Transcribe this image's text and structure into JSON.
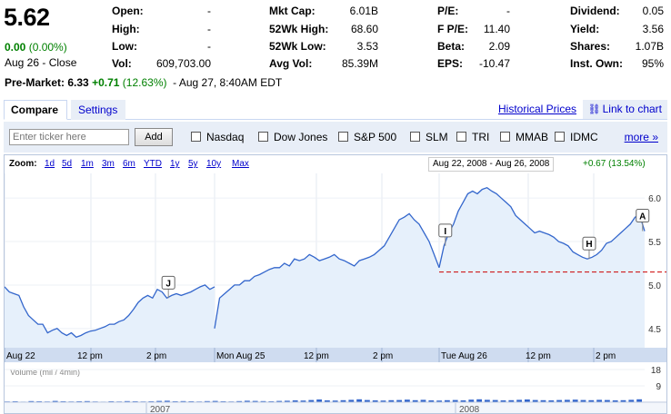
{
  "quote": {
    "price": "5.62",
    "change": "0.00",
    "change_pct": "(0.00%)",
    "close_info": "Aug 26 - Close",
    "premarket_label": "Pre-Market:",
    "premarket_price": "6.33",
    "premarket_change": "+0.71",
    "premarket_pct": "(12.63%)",
    "premarket_time": "- Aug 27, 8:40AM EDT"
  },
  "stats": [
    {
      "label": "Open:",
      "value": "-"
    },
    {
      "label": "High:",
      "value": "-"
    },
    {
      "label": "Low:",
      "value": "-"
    },
    {
      "label": "Vol:",
      "value": "609,703.00"
    },
    {
      "label": "Mkt Cap:",
      "value": "6.01B"
    },
    {
      "label": "52Wk High:",
      "value": "68.60"
    },
    {
      "label": "52Wk Low:",
      "value": "3.53"
    },
    {
      "label": "Avg Vol:",
      "value": "85.39M"
    },
    {
      "label": "P/E:",
      "value": "-"
    },
    {
      "label": "F P/E:",
      "value": "11.40"
    },
    {
      "label": "Beta:",
      "value": "2.09"
    },
    {
      "label": "EPS:",
      "value": "-10.47"
    },
    {
      "label": "Dividend:",
      "value": "0.05"
    },
    {
      "label": "Yield:",
      "value": "3.56"
    },
    {
      "label": "Shares:",
      "value": "1.07B"
    },
    {
      "label": "Inst. Own:",
      "value": "95%"
    }
  ],
  "tabs": {
    "compare": "Compare",
    "settings": "Settings",
    "historical": "Historical Prices",
    "link_chart": "Link to chart"
  },
  "compare": {
    "placeholder": "Enter ticker here",
    "add_label": "Add",
    "items": [
      "Nasdaq",
      "Dow Jones",
      "S&P 500",
      "SLM",
      "TRI",
      "MMAB",
      "IDMC"
    ],
    "more": "more »"
  },
  "zoom": {
    "label": "Zoom:",
    "options": [
      "1d",
      "5d",
      "1m",
      "3m",
      "6m",
      "YTD",
      "1y",
      "5y",
      "10y",
      "Max"
    ],
    "range_start": "Aug 22, 2008",
    "range_sep": "-",
    "range_end": "Aug 26, 2008",
    "range_change": "+0.67 (13.54%)"
  },
  "chart_data": {
    "type": "line",
    "x_labels": [
      "Aug 22",
      "12 pm",
      "2 pm",
      "Mon Aug 25",
      "12 pm",
      "2 pm",
      "Tue Aug 26",
      "12 pm",
      "2 pm"
    ],
    "y_ticks": [
      4.5,
      5.0,
      5.5,
      6.0
    ],
    "ylim": [
      4.3,
      6.2
    ],
    "reference_line": 5.15,
    "annotations": [
      {
        "label": "J",
        "session": 0,
        "t": 0.78
      },
      {
        "label": "I",
        "session": 2,
        "t": 0.03
      },
      {
        "label": "H",
        "session": 2,
        "t": 0.73
      },
      {
        "label": "A",
        "session": 2,
        "t": 0.99
      }
    ],
    "sessions": [
      [
        4.98,
        4.92,
        4.9,
        4.88,
        4.75,
        4.65,
        4.6,
        4.55,
        4.55,
        4.45,
        4.48,
        4.5,
        4.45,
        4.42,
        4.45,
        4.4,
        4.42,
        4.45,
        4.47,
        4.48,
        4.5,
        4.52,
        4.55,
        4.55,
        4.58,
        4.6,
        4.65,
        4.72,
        4.8,
        4.85,
        4.88,
        4.85,
        4.95,
        4.92,
        4.85,
        4.88,
        4.9,
        4.88,
        4.9,
        4.92,
        4.95,
        4.98,
        5.0,
        4.95,
        4.98
      ],
      [
        4.5,
        4.85,
        4.9,
        4.95,
        5.0,
        5.0,
        5.05,
        5.05,
        5.1,
        5.12,
        5.15,
        5.18,
        5.2,
        5.2,
        5.25,
        5.22,
        5.3,
        5.28,
        5.3,
        5.35,
        5.32,
        5.28,
        5.3,
        5.32,
        5.35,
        5.3,
        5.28,
        5.25,
        5.22,
        5.28,
        5.3,
        5.32,
        5.35,
        5.4,
        5.45,
        5.55,
        5.65,
        5.75,
        5.78,
        5.82,
        5.75,
        5.7,
        5.6,
        5.5,
        5.35,
        5.2
      ],
      [
        5.2,
        5.45,
        5.6,
        5.7,
        5.85,
        5.95,
        6.05,
        6.08,
        6.05,
        6.1,
        6.12,
        6.08,
        6.05,
        6.0,
        5.95,
        5.9,
        5.8,
        5.75,
        5.7,
        5.65,
        5.6,
        5.62,
        5.6,
        5.58,
        5.55,
        5.5,
        5.48,
        5.45,
        5.38,
        5.35,
        5.32,
        5.3,
        5.32,
        5.35,
        5.4,
        5.48,
        5.5,
        5.55,
        5.6,
        5.65,
        5.7,
        5.78,
        5.8,
        5.62
      ]
    ],
    "volume_label": "Volume (mil / 4min)",
    "volume_ticks": [
      18,
      9
    ],
    "volume": [
      0.4,
      0.5,
      0.3,
      0.6,
      0.5,
      0.4,
      0.7,
      0.5,
      0.4,
      0.5,
      0.6,
      0.4,
      0.3,
      0.5,
      0.4,
      0.6,
      0.5,
      0.4,
      0.5,
      0.7,
      0.8,
      0.5,
      0.6,
      0.5,
      0.4,
      0.6,
      0.7,
      0.5,
      0.4,
      0.6,
      0.8,
      0.7,
      0.6,
      0.5,
      0.7,
      0.8,
      1.0,
      0.9,
      1.2,
      1.5,
      1.0,
      0.9,
      1.1,
      1.3,
      1.6,
      1.2,
      1.0,
      0.9,
      1.1,
      1.2,
      1.4,
      1.1,
      1.3,
      1.0,
      0.9,
      1.1,
      1.2,
      1.0,
      1.4,
      1.6,
      1.3,
      1.2,
      1.0,
      1.1,
      1.3,
      1.5,
      1.2,
      1.1,
      1.0,
      1.2,
      1.3,
      1.4,
      1.2,
      1.1,
      1.3,
      1.2,
      1.0,
      1.1,
      1.3,
      1.6
    ],
    "lower_labels": [
      "2007",
      "2008"
    ]
  }
}
